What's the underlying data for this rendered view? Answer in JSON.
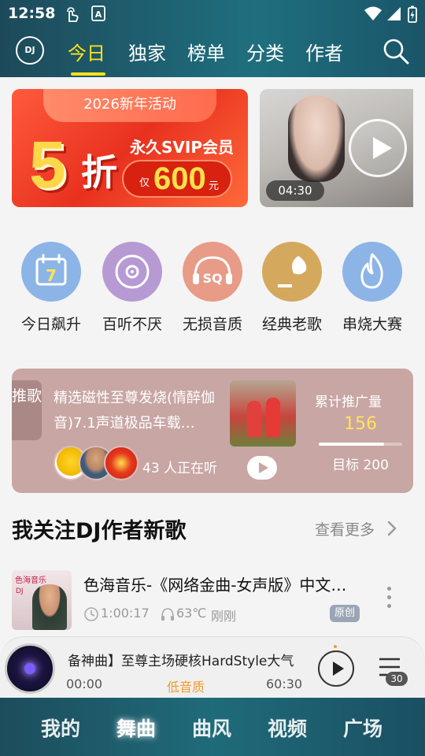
{
  "status_bar": {
    "time": "12:58"
  },
  "header": {
    "logo_text": "DJ",
    "tabs": [
      {
        "label": "今日",
        "active": true
      },
      {
        "label": "独家",
        "active": false
      },
      {
        "label": "榜单",
        "active": false
      },
      {
        "label": "分类",
        "active": false
      },
      {
        "label": "作者",
        "active": false
      }
    ]
  },
  "promo": {
    "ribbon": "2026新年活动",
    "discount_number": "5",
    "discount_char": "折",
    "title": "永久SVIP会员",
    "price_prefix": "仅",
    "price": "600",
    "price_unit": "元"
  },
  "video_banner": {
    "duration": "04:30"
  },
  "categories": [
    {
      "label": "今日飙升",
      "icon": "calendar-icon",
      "color": "#8cb4e6"
    },
    {
      "label": "百听不厌",
      "icon": "disc-icon",
      "color": "#b79ad3"
    },
    {
      "label": "无损音质",
      "icon": "sq-headphones-icon",
      "color": "#e89b86"
    },
    {
      "label": "经典老歌",
      "icon": "gramophone-icon",
      "color": "#d4a95e"
    },
    {
      "label": "串烧大赛",
      "icon": "flame-icon",
      "color": "#8cb4e6"
    }
  ],
  "recommend": {
    "tag": "推歌",
    "title": "精选磁性至尊发烧(情醉伽音)7.1声道极品车载…",
    "listening": "43 人正在听",
    "stat_label": "累计推广量",
    "stat_value": "156",
    "goal": "目标 200",
    "progress": 0.78
  },
  "section": {
    "title": "我关注DJ作者新歌",
    "more": "查看更多"
  },
  "song": {
    "cover_title": "色海音乐",
    "cover_side": "DJ",
    "title": "色海音乐-《网络金曲-女声版》中文…",
    "duration": "1:00:17",
    "heat": "63℃",
    "time_ago": "刚刚",
    "badge": "原创"
  },
  "player": {
    "track": "备神曲】至尊主场硬核HardStyle大气",
    "elapsed": "00:00",
    "quality": "低音质",
    "total": "60:30",
    "queue_count": "30"
  },
  "bottom_nav": [
    {
      "label": "我的",
      "active": false
    },
    {
      "label": "舞曲",
      "active": true
    },
    {
      "label": "曲风",
      "active": false
    },
    {
      "label": "视频",
      "active": false
    },
    {
      "label": "广场",
      "active": false
    }
  ]
}
